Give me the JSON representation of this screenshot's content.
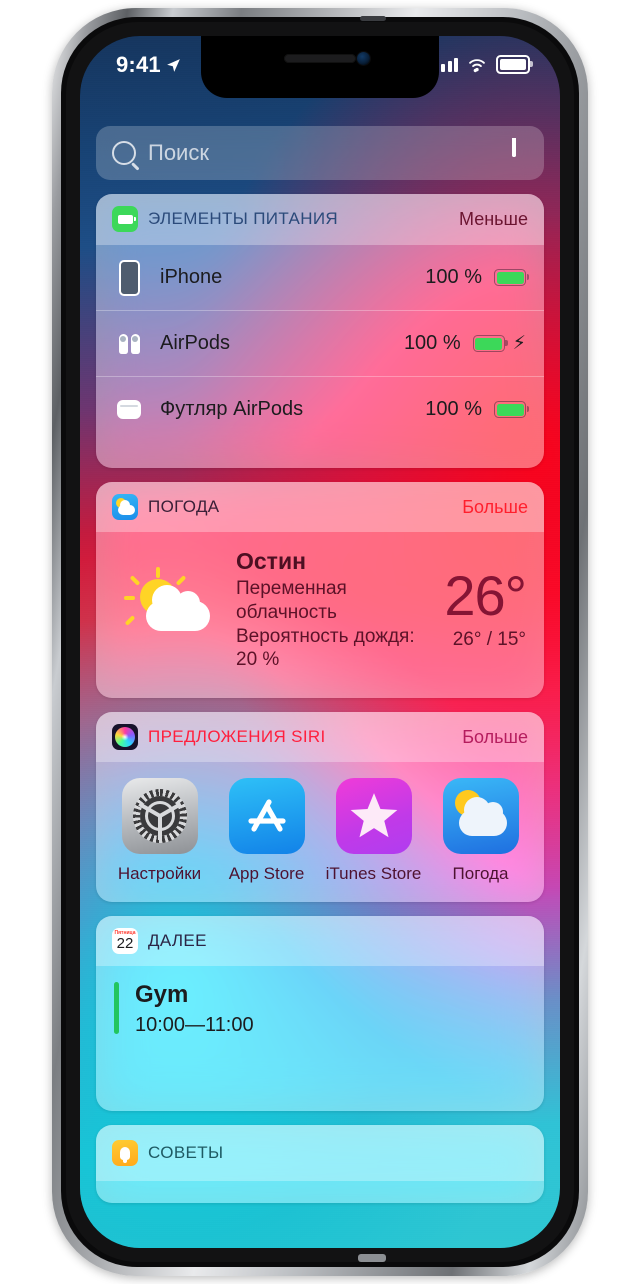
{
  "status_bar": {
    "time": "9:41",
    "location_icon": "location-arrow-icon",
    "signal_icon": "cellular-bars-icon",
    "wifi_icon": "wifi-icon",
    "battery_icon": "battery-full-icon"
  },
  "search": {
    "placeholder": "Поиск",
    "search_icon": "search-icon",
    "mic_icon": "microphone-icon"
  },
  "widgets": {
    "batteries": {
      "icon": "battery-app-icon",
      "title": "ЭЛЕМЕНТЫ ПИТАНИЯ",
      "action": "Меньше",
      "rows": [
        {
          "icon": "iphone-icon",
          "name": "iPhone",
          "percent": "100 %",
          "charging": false
        },
        {
          "icon": "airpods-icon",
          "name": "AirPods",
          "percent": "100 %",
          "charging": true,
          "bolt": "⚡"
        },
        {
          "icon": "airpods-case-icon",
          "name": "Футляр AirPods",
          "percent": "100 %",
          "charging": false
        }
      ]
    },
    "weather": {
      "icon": "weather-app-icon",
      "title": "ПОГОДА",
      "action": "Больше",
      "art_icon": "sun-behind-cloud-icon",
      "city": "Остин",
      "condition": "Переменная облачность",
      "rain": "Вероятность дождя: 20 %",
      "temperature": "26°",
      "high_low": "26° / 15°"
    },
    "siri": {
      "icon": "siri-app-icon",
      "title": "ПРЕДЛОЖЕНИЯ SIRI",
      "action": "Больше",
      "apps": [
        {
          "icon": "settings-app-icon",
          "label": "Настройки"
        },
        {
          "icon": "app-store-app-icon",
          "label": "App Store"
        },
        {
          "icon": "itunes-store-app-icon",
          "label": "iTunes Store"
        },
        {
          "icon": "weather-app-icon",
          "label": "Погода"
        }
      ]
    },
    "up_next": {
      "icon": "calendar-app-icon",
      "icon_weekday": "Пятница",
      "icon_day": "22",
      "title": "ДАЛЕЕ",
      "event_title": "Gym",
      "event_time": "10:00—11:00",
      "event_color": "#22c55e"
    },
    "tips": {
      "icon": "tips-app-icon",
      "title": "СОВЕТЫ"
    }
  },
  "colors": {
    "battery_green": "#3cd859",
    "weather_red": "#851434",
    "siri_red": "#ff1f3d",
    "calendar_dark": "#2b2545",
    "tips_teal": "#1e5a63"
  }
}
